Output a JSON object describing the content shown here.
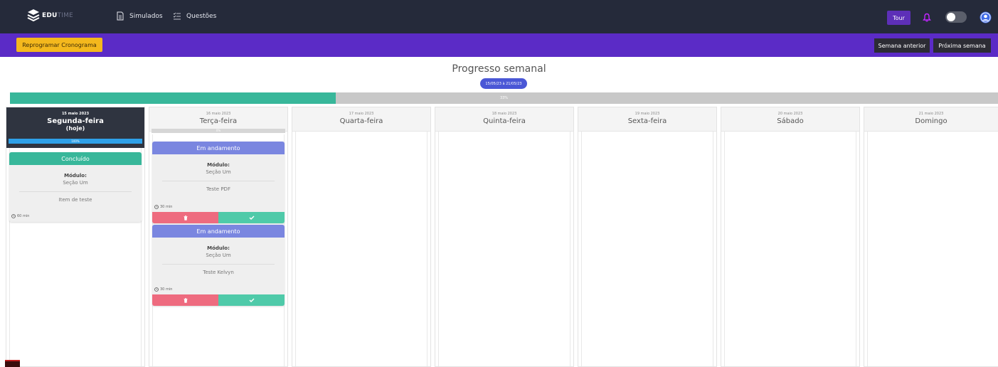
{
  "app": {
    "logo_text_primary": "EDU",
    "logo_text_secondary": "TIME"
  },
  "nav": {
    "simulados": "Simulados",
    "questoes": "Questões",
    "tour": "Tour"
  },
  "toolbar": {
    "reprogramar": "Reprogramar Cronograma",
    "semana_anterior": "Semana anterior",
    "proxima_semana": "Próxima semana"
  },
  "weekly": {
    "title": "Progresso semanal",
    "range": "15/05/23 à 21/05/23",
    "progress_label": "33%",
    "progress_value": 0.33
  },
  "colors": {
    "navbar": "#252a3a",
    "accent_purple": "#5b2bc6",
    "reprogram_yellow": "#f4b81d",
    "progress_green": "#38b79a",
    "day_progress_blue": "#2ea0e8",
    "status_done": "#38b79a",
    "status_in_progress": "#7a86e0",
    "delete_red": "#ee6b7f",
    "confirm_green": "#4fcaa9"
  },
  "days": [
    {
      "date": "15 maio 2023",
      "name": "Segunda-feira",
      "today_label": "(hoje)",
      "progress_label": "100%",
      "progress_value": 1.0,
      "tasks": [
        {
          "status": "Concluído",
          "module_label": "Módulo:",
          "module_value": "Seção Um",
          "item": "Item de teste",
          "duration": "60 min"
        }
      ]
    },
    {
      "date": "16 maio 2023",
      "name": "Terça-feira",
      "progress_label": "0%",
      "progress_value": 0.0,
      "tasks": [
        {
          "status": "Em andamento",
          "module_label": "Módulo:",
          "module_value": "Seção Um",
          "item": "Teste PDF",
          "duration": "30 min"
        },
        {
          "status": "Em andamento",
          "module_label": "Módulo:",
          "module_value": "Seção Um",
          "item": "Teste Kelvyn",
          "duration": "30 min"
        }
      ]
    },
    {
      "date": "17 maio 2023",
      "name": "Quarta-feira"
    },
    {
      "date": "18 maio 2023",
      "name": "Quinta-feira"
    },
    {
      "date": "19 maio 2023",
      "name": "Sexta-feira"
    },
    {
      "date": "20 maio 2023",
      "name": "Sábado"
    },
    {
      "date": "21 maio 2023",
      "name": "Domingo"
    }
  ],
  "icons": {
    "logo": "edutime-logo-icon",
    "simulados": "document-icon",
    "questoes": "checklist-icon",
    "notifications": "bell-icon",
    "theme_toggle": "toggle-switch",
    "profile": "user-circle-icon",
    "duration": "clock-icon",
    "delete": "trash-icon",
    "confirm": "check-icon"
  }
}
